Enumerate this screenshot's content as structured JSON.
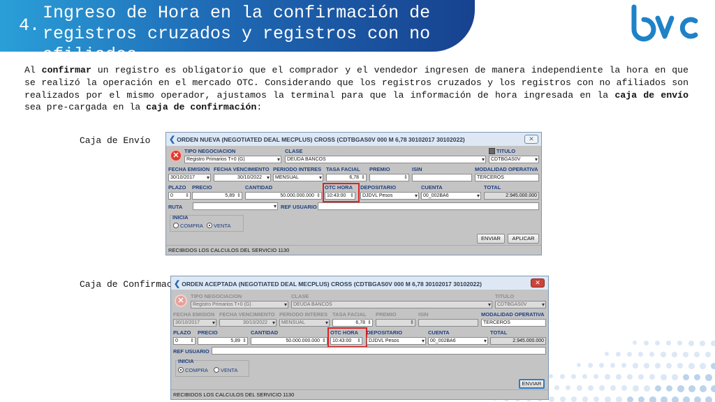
{
  "header": {
    "number": "4.",
    "title": "Ingreso de Hora en la confirmación de registros cruzados y registros con no afiliados"
  },
  "logo": {
    "text": "bvc",
    "color": "#1f82c7"
  },
  "paragraph": {
    "p1": "Al ",
    "b1": "confirmar",
    "p2": " un registro es obligatorio que el comprador y el vendedor ingresen de manera independiente la hora en que se realizó la operación en el mercado OTC. Considerando que los registros cruzados y los registros con no afiliados son realizados por el mismo operador, ajustamos la terminal para que la información de hora ingresada en la ",
    "b2": "caja de envío",
    "p3": " sea pre-cargada en la ",
    "b3": "caja de confirmación",
    "p4": ":"
  },
  "labels": {
    "envio": "Caja de Envío",
    "confirmacion": "Caja de Confirmación"
  },
  "win1": {
    "title": "ORDEN NUEVA (NEGOTIATED DEAL MECPLUS) CROSS (CDTBGAS0V 000 M 6,78 30102017 30102022)",
    "close": "✕",
    "h_tipo": "TIPO NEGOCIACION",
    "v_tipo": "Registro Primarios T+0 (G)",
    "h_clase": "CLASE",
    "v_clase": "DEUDA BANCOS",
    "h_titulo": "TITULO",
    "v_titulo": "CDTBGAS0V",
    "h_fe": "FECHA EMISION",
    "v_fe": "30/10/2017",
    "h_fv": "FECHA VENCIMIENTO",
    "v_fv": "30/10/2022",
    "h_pi": "PERIODO INTERES",
    "v_pi": "MENSUAL",
    "h_tf": "TASA FACIAL",
    "v_tf": "6,78",
    "h_pr": "PREMIO",
    "h_isin": "ISIN",
    "h_mo": "MODALIDAD OPERATIVA",
    "v_mo": "TERCEROS",
    "h_plazo": "PLAZO",
    "v_plazo": "0",
    "h_precio": "PRECIO",
    "v_precio": "5,89",
    "h_cant": "CANTIDAD",
    "v_cant": "50.000.000.000",
    "h_otc": "OTC HORA",
    "v_otc": "10:43:00",
    "h_dep": "DEPOSITARIO",
    "v_dep": "DJDVL Pesos",
    "h_cta": "CUENTA",
    "v_cta": "00_002BA6",
    "h_total": "TOTAL",
    "v_total": "2.945.000.000",
    "h_ruta": "RUTA",
    "h_ref": "REF USUARIO",
    "h_inicia": "INICIA",
    "r_compra": "COMPRA",
    "r_venta": "VENTA",
    "b_enviar": "ENVIAR",
    "b_aplicar": "APLICAR",
    "status": "RECIBIDOS LOS CALCULOS DEL SERVICIO 1130"
  },
  "win2": {
    "title": "ORDEN ACEPTADA (NEGOTIATED DEAL MECPLUS) CROSS (CDTBGAS0V 000 M 6,78 30102017 30102022)",
    "close": "✕",
    "h_tipo": "TIPO NEGOCIACION",
    "v_tipo": "Registro Primarios T+0 (G)",
    "h_clase": "CLASE",
    "v_clase": "DEUDA BANCOS",
    "h_titulo": "TITULO",
    "v_titulo": "CDTBGAS0V",
    "h_fe": "FECHA EMISION",
    "v_fe": "30/10/2017",
    "h_fv": "FECHA VENCIMIENTO",
    "v_fv": "30/10/2022",
    "h_pi": "PERIODO INTERES",
    "v_pi": "MENSUAL",
    "h_tf": "TASA FACIAL",
    "v_tf": "6,78",
    "h_pr": "PREMIO",
    "h_isin": "ISIN",
    "h_mo": "MODALIDAD OPERATIVA",
    "v_mo": "TERCEROS",
    "h_plazo": "PLAZO",
    "v_plazo": "0",
    "h_precio": "PRECIO",
    "v_precio": "5,89",
    "h_cant": "CANTIDAD",
    "v_cant": "50.000.000.000",
    "h_otc": "OTC HORA",
    "v_otc": "10:43:00",
    "h_dep": "DEPOSITARIO",
    "v_dep": "DJDVL Pesos",
    "h_cta": "CUENTA",
    "v_cta": "00_002BA6",
    "h_total": "TOTAL",
    "v_total": "2.945.000.000",
    "h_ref": "REF USUARIO",
    "h_inicia": "INICIA",
    "r_compra": "COMPRA",
    "r_venta": "VENTA",
    "b_enviar": "ENVIAR",
    "status": "RECIBIDOS LOS CALCULOS DEL SERVICIO 1130"
  }
}
